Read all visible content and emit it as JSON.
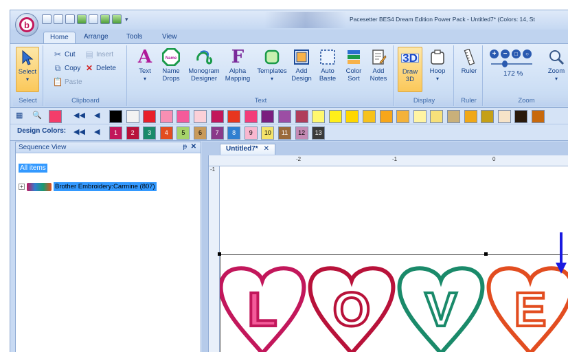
{
  "window": {
    "title": "Pacesetter BES4 Dream Edition Power Pack - Untitled7* (Colors: 14, St",
    "logo_letter": "b"
  },
  "tabs": [
    "Home",
    "Arrange",
    "Tools",
    "View"
  ],
  "ribbon": {
    "select": {
      "button": "Select",
      "group": "Select"
    },
    "clipboard": {
      "cut": "Cut",
      "copy": "Copy",
      "paste": "Paste",
      "insert": "Insert",
      "delete": "Delete",
      "group": "Clipboard"
    },
    "text": {
      "group": "Text",
      "buttons": [
        {
          "l1": "Text",
          "l2": "▾",
          "icon": "letter-a-icon"
        },
        {
          "l1": "Name",
          "l2": "Drops",
          "icon": "name-drop-icon"
        },
        {
          "l1": "Monogram",
          "l2": "Designer",
          "icon": "monogram-icon"
        },
        {
          "l1": "Alpha",
          "l2": "Mapping",
          "icon": "alpha-mapping-icon"
        },
        {
          "l1": "Templates",
          "l2": "▾",
          "icon": "templates-icon"
        },
        {
          "l1": "Add",
          "l2": "Design",
          "icon": "add-design-icon"
        },
        {
          "l1": "Auto",
          "l2": "Baste",
          "icon": "auto-baste-icon"
        },
        {
          "l1": "Color",
          "l2": "Sort",
          "icon": "color-sort-icon"
        },
        {
          "l1": "Add",
          "l2": "Notes",
          "icon": "add-notes-icon"
        }
      ]
    },
    "display": {
      "group": "Display",
      "draw3d_l1": "Draw",
      "draw3d_l2": "3D",
      "draw3d_icon": "3D",
      "hoop_l1": "Hoop",
      "hoop_l2": "▾"
    },
    "ruler": {
      "group": "Ruler",
      "label": "Ruler"
    },
    "zoom": {
      "group": "Zoom",
      "percent": "172 %",
      "label": "Zoom",
      "label2": "▾"
    }
  },
  "palette": {
    "colors": [
      "#000000",
      "#f2f2f2",
      "#e8202a",
      "#f78fb3",
      "#f45b9a",
      "#fbd0d8",
      "#c2175b",
      "#e8361e",
      "#f33d7a",
      "#7a1f7f",
      "#9c4ea4",
      "#b03c5a",
      "#fff86e",
      "#ffef1a",
      "#ffd700",
      "#f7c21b",
      "#f7a61a",
      "#f4b23a",
      "#fff4a3",
      "#f7e07a",
      "#c9b07a",
      "#f0a818",
      "#c5a016",
      "#f6e3c8",
      "#2a1a0c",
      "#c8690c"
    ],
    "design_colors_label": "Design Colors:",
    "design_colors": [
      {
        "n": "1",
        "c": "#c2175b",
        "t": "#ffffff"
      },
      {
        "n": "2",
        "c": "#b8123a",
        "t": "#ffffff"
      },
      {
        "n": "3",
        "c": "#1a8a6a",
        "t": "#ffffff"
      },
      {
        "n": "4",
        "c": "#e24d20",
        "t": "#ffffff"
      },
      {
        "n": "5",
        "c": "#a6d36a",
        "t": "#000000"
      },
      {
        "n": "6",
        "c": "#c89a5a",
        "t": "#000000"
      },
      {
        "n": "7",
        "c": "#8a3a8a",
        "t": "#ffffff"
      },
      {
        "n": "8",
        "c": "#2f7fd0",
        "t": "#ffffff"
      },
      {
        "n": "9",
        "c": "#f8b7cf",
        "t": "#000000"
      },
      {
        "n": "10",
        "c": "#f4e36a",
        "t": "#000000"
      },
      {
        "n": "11",
        "c": "#9a6a3a",
        "t": "#ffffff"
      },
      {
        "n": "12",
        "c": "#c48ab4",
        "t": "#000000"
      },
      {
        "n": "13",
        "c": "#3a3a3a",
        "t": "#ffffff"
      }
    ]
  },
  "sequence": {
    "title": "Sequence View",
    "pin": "ᵽ",
    "close": "✕",
    "all_items": "All items",
    "item_expand": "+",
    "item_label": "Brother Embroidery:Carmine (807)"
  },
  "document": {
    "tab_label": "Untitled7*",
    "tab_close": "✕",
    "ruler_top": [
      "-2",
      "-1",
      "0"
    ],
    "ruler_left": [
      "-1"
    ],
    "design_letters": [
      "L",
      "O",
      "V",
      "E"
    ],
    "heart_colors": [
      "#c2175b",
      "#b8123a",
      "#1a8a6a",
      "#e24d20"
    ],
    "letter_fill": "#f45b9a"
  }
}
